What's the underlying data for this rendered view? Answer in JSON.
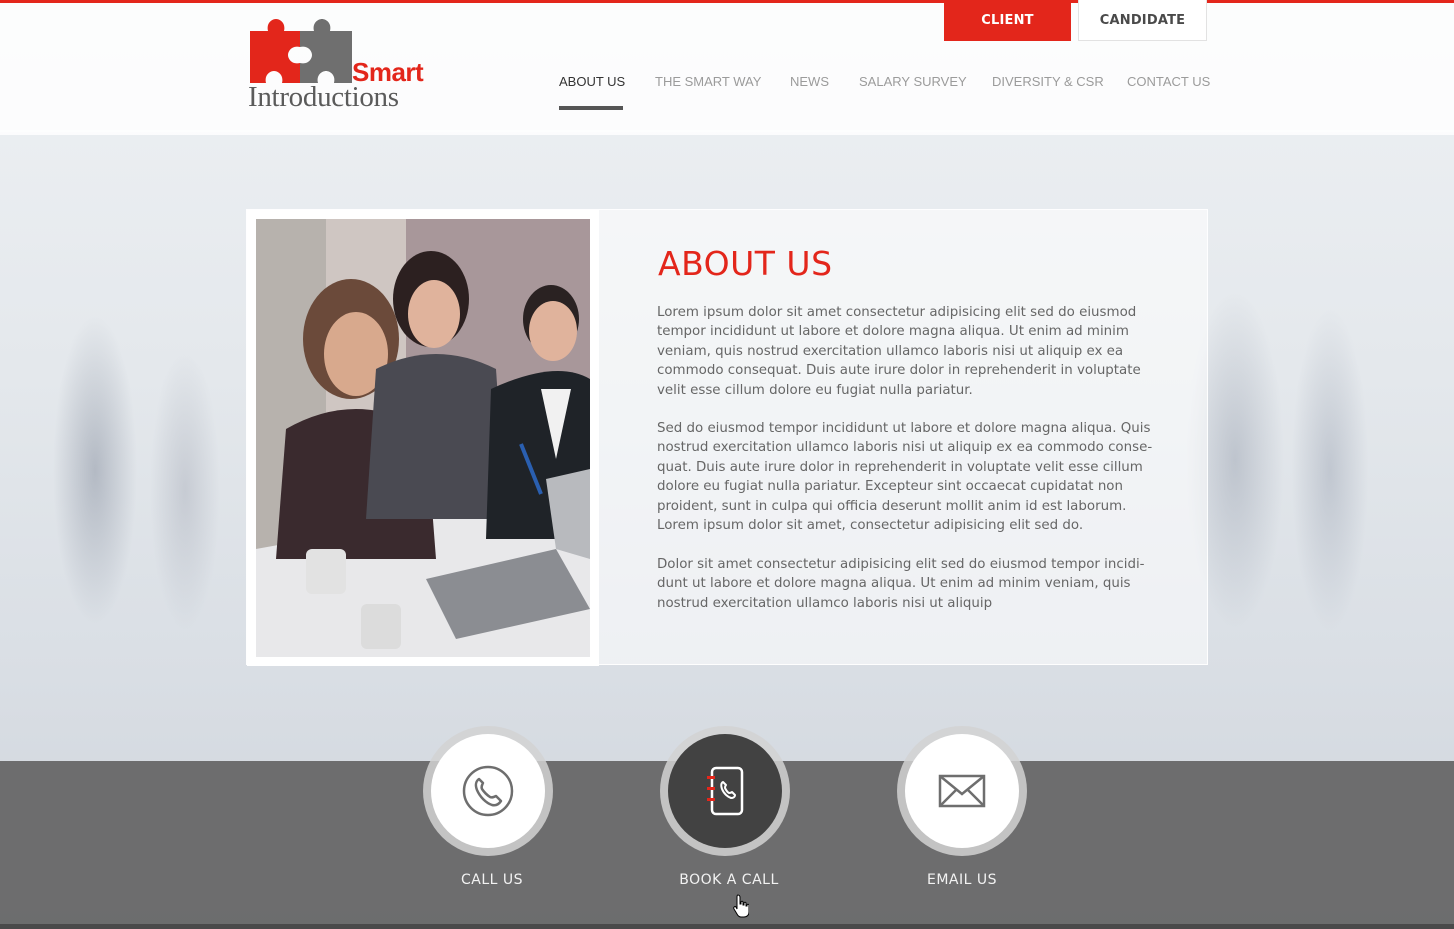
{
  "brand": {
    "logo_word_1": "Smart",
    "logo_word_2": "Introductions",
    "accent_color": "#e3261b"
  },
  "auth": {
    "client_label": "CLIENT",
    "candidate_label": "CANDIDATE"
  },
  "nav": {
    "items": [
      {
        "label": "ABOUT US",
        "active": true
      },
      {
        "label": "THE SMART WAY",
        "active": false
      },
      {
        "label": "NEWS",
        "active": false
      },
      {
        "label": "SALARY SURVEY",
        "active": false
      },
      {
        "label": "DIVERSITY & CSR",
        "active": false
      },
      {
        "label": "CONTACT US",
        "active": false
      }
    ]
  },
  "about": {
    "title": "ABOUT US",
    "paragraph_1": "Lorem ipsum dolor sit amet consectetur adipisicing elit sed do eiusmod tempor incididunt ut labore et dolore magna aliqua. Ut enim ad minim veniam, quis nostrud exercitation ullamco laboris nisi ut aliquip ex ea commodo consequat. Duis aute irure dolor in reprehenderit in voluptate velit esse cillum dolore eu fugiat nulla pariatur.",
    "paragraph_2": "Sed do eiusmod tempor incididunt ut labore et dolore magna aliqua. Quis nostrud exercitation ullamco laboris nisi ut aliquip ex ea commodo conse-quat. Duis aute irure dolor in reprehenderit in voluptate velit esse cillum dolore eu fugiat nulla pariatur. Excepteur sint occaecat cupidatat non proident, sunt in culpa qui officia deserunt mollit anim id est laborum. Lorem ipsum dolor sit amet, consectetur adipisicing elit sed do.",
    "paragraph_3": "Dolor sit amet consectetur adipisicing elit sed do eiusmod tempor incidi-dunt ut labore et dolore magna aliqua. Ut enim ad minim veniam, quis nostrud exercitation ullamco laboris nisi ut aliquip"
  },
  "actions": {
    "call": {
      "label": "CALL US",
      "icon": "phone-icon"
    },
    "book": {
      "label": "BOOK A CALL",
      "icon": "phone-book-icon"
    },
    "email": {
      "label": "EMAIL US",
      "icon": "envelope-icon"
    }
  }
}
